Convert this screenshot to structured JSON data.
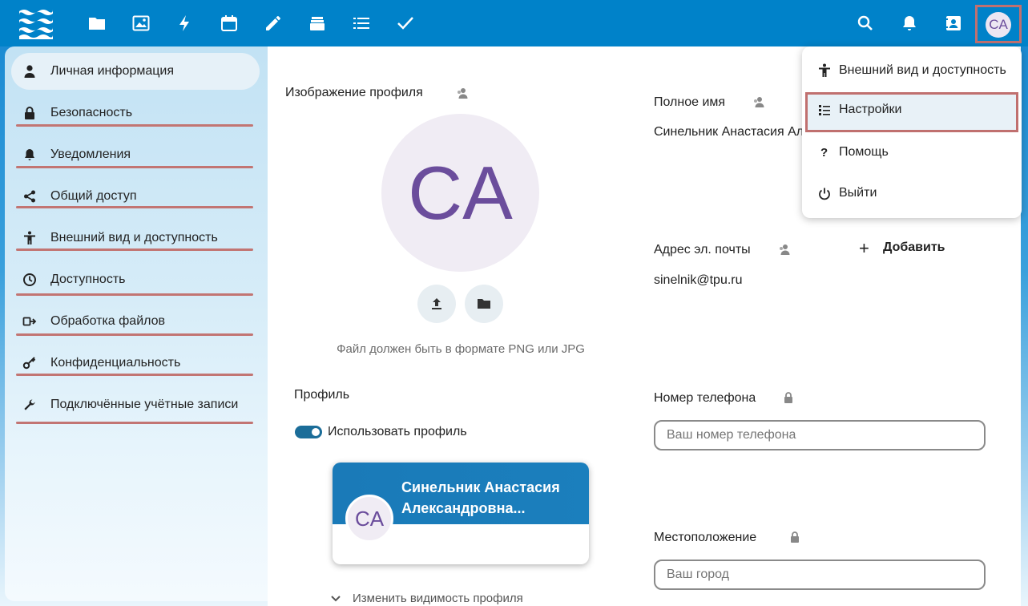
{
  "header": {
    "nav_icons": [
      "files-icon",
      "photos-icon",
      "activity-icon",
      "calendar-icon",
      "notes-icon",
      "deck-icon",
      "tasks-icon",
      "checkmark-icon"
    ],
    "right_icons": [
      "search-icon",
      "bell-icon",
      "contacts-icon"
    ],
    "avatar_initials": "CA",
    "accent_color": "#0082c9"
  },
  "sidebar": {
    "items": [
      {
        "label": "Личная информация",
        "icon": "user-icon",
        "active": true
      },
      {
        "label": "Безопасность",
        "icon": "lock-icon"
      },
      {
        "label": "Уведомления",
        "icon": "bell-icon"
      },
      {
        "label": "Общий доступ",
        "icon": "share-icon"
      },
      {
        "label": "Внешний вид и доступность",
        "icon": "accessibility-icon"
      },
      {
        "label": "Доступность",
        "icon": "clock-icon"
      },
      {
        "label": "Обработка файлов",
        "icon": "workflow-icon"
      },
      {
        "label": "Конфиденциальность",
        "icon": "key-icon"
      },
      {
        "label": "Подключённые учётные записи",
        "icon": "wrench-icon"
      }
    ]
  },
  "profile_image": {
    "title": "Изображение профиля",
    "initials": "CA",
    "hint": "Файл должен быть в формате PNG или JPG"
  },
  "profile": {
    "title": "Профиль",
    "toggle_label": "Использовать профиль",
    "toggle_on": true,
    "card_name": "Синельник Анастасия Александровна...",
    "card_initials": "CA",
    "visibility_label": "Изменить видимость профиля"
  },
  "full_name": {
    "label": "Полное имя",
    "value": "Синельник Анастасия Ал"
  },
  "email": {
    "label": "Адрес эл. почты",
    "add_label": "Добавить",
    "value": "sinelnik@tpu.ru"
  },
  "phone": {
    "label": "Номер телефона",
    "placeholder": "Ваш номер телефона"
  },
  "location": {
    "label": "Местоположение",
    "placeholder": "Ваш город"
  },
  "menu": {
    "items": [
      {
        "label": "Внешний вид и доступность",
        "icon": "accessibility-icon"
      },
      {
        "label": "Настройки",
        "icon": "settings-list-icon",
        "highlighted": true
      },
      {
        "label": "Помощь",
        "icon": "help-icon"
      },
      {
        "label": "Выйти",
        "icon": "power-icon"
      }
    ]
  }
}
